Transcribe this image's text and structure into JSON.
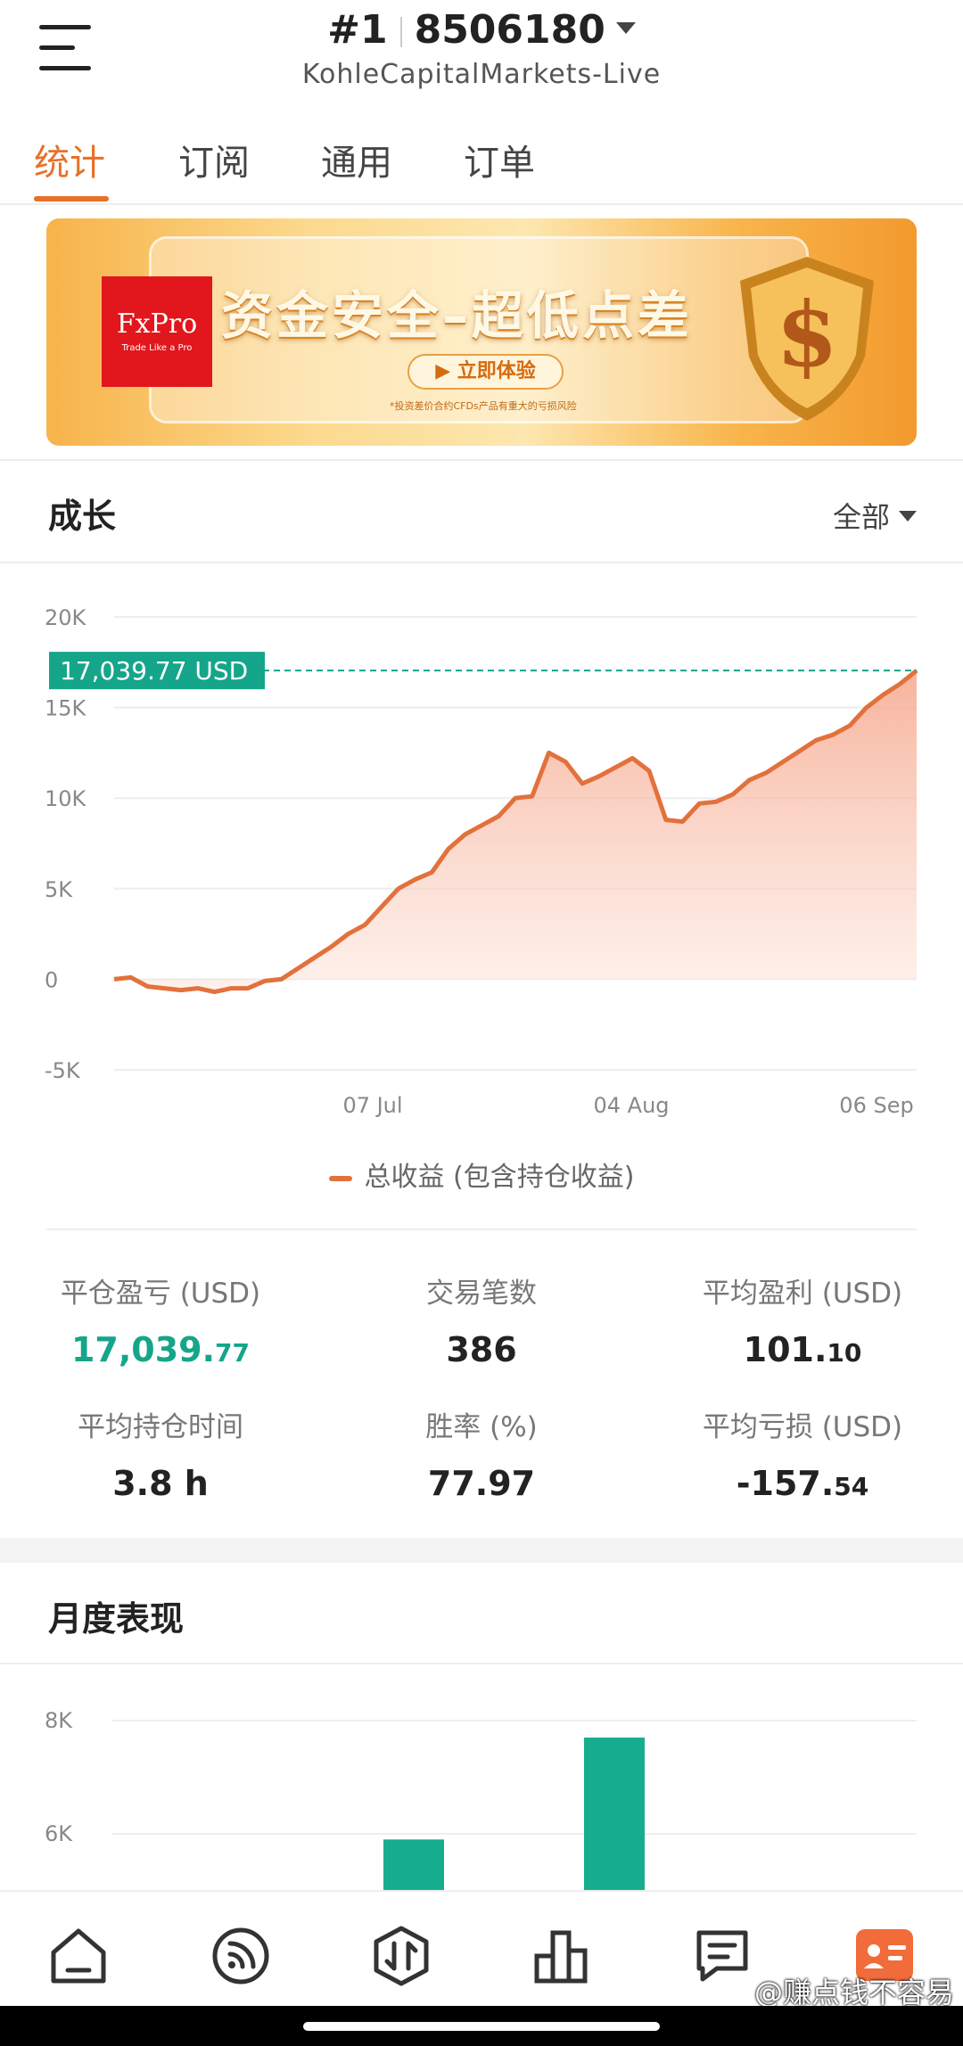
{
  "header": {
    "rank": "#1",
    "account_number": "8506180",
    "server": "KohleCapitalMarkets-Live"
  },
  "tabs": [
    {
      "label": "统计",
      "active": true
    },
    {
      "label": "订阅",
      "active": false
    },
    {
      "label": "通用",
      "active": false
    },
    {
      "label": "订单",
      "active": false
    }
  ],
  "banner": {
    "brand": "FxPro",
    "brand_slogan": "Trade Like a Pro",
    "headline": "资金安全–超低点差",
    "cta": "立即体验",
    "note": "*投资差价合约CFDs产品有重大的亏损风险"
  },
  "growth": {
    "title": "成长",
    "filter": "全部",
    "current_value_tag": "17,039.77 USD",
    "legend": "总收益 (包含持仓收益)"
  },
  "chart_data": {
    "type": "area",
    "title": "",
    "xlabel": "",
    "ylabel": "",
    "ylim": [
      -5000,
      20000
    ],
    "y_ticks": [
      "20K",
      "15K",
      "10K",
      "5K",
      "0",
      "-5K"
    ],
    "x_ticks": [
      "07 Jul",
      "04 Aug",
      "06 Sep"
    ],
    "series": [
      {
        "name": "总收益 (包含持仓收益)",
        "color": "#e2713c",
        "values": [
          0,
          100,
          -400,
          -500,
          -600,
          -500,
          -700,
          -500,
          -500,
          -100,
          0,
          600,
          1200,
          1800,
          2500,
          3000,
          4000,
          5000,
          5500,
          5900,
          7200,
          8000,
          8500,
          9000,
          10000,
          10100,
          12500,
          12000,
          10800,
          11200,
          11700,
          12200,
          11500,
          8800,
          8700,
          9700,
          9800,
          10200,
          11000,
          11400,
          12000,
          12600,
          13200,
          13500,
          14000,
          15000,
          15700,
          16300,
          17039.77
        ]
      }
    ]
  },
  "stats": [
    {
      "label": "平仓盈亏 (USD)",
      "value_int": "17,039.",
      "value_dec": "77",
      "color": "#15a58a"
    },
    {
      "label": "交易笔数",
      "value_int": "386",
      "value_dec": ""
    },
    {
      "label": "平均盈利 (USD)",
      "value_int": "101.",
      "value_dec": "10"
    },
    {
      "label": "平均持仓时间",
      "value_int": "3.8 h",
      "value_dec": ""
    },
    {
      "label": "胜率 (%)",
      "value_int": "77.97",
      "value_dec": ""
    },
    {
      "label": "平均亏损 (USD)",
      "value_int": "-157.",
      "value_dec": "54"
    }
  ],
  "monthly": {
    "title": "月度表现",
    "y_ticks": [
      "8K",
      "6K"
    ],
    "bars_visible": [
      {
        "value": 5900,
        "color": "#16ad8f"
      },
      {
        "value": 7700,
        "color": "#16ad8f"
      }
    ]
  },
  "bottom_nav": [
    {
      "icon": "home-icon"
    },
    {
      "icon": "signal-feed-icon"
    },
    {
      "icon": "trade-icon"
    },
    {
      "icon": "chart-icon"
    },
    {
      "icon": "news-icon"
    },
    {
      "icon": "profile-card-icon",
      "active": true,
      "color": "#f26b3a"
    }
  ],
  "watermark": "@赚点钱不容易"
}
